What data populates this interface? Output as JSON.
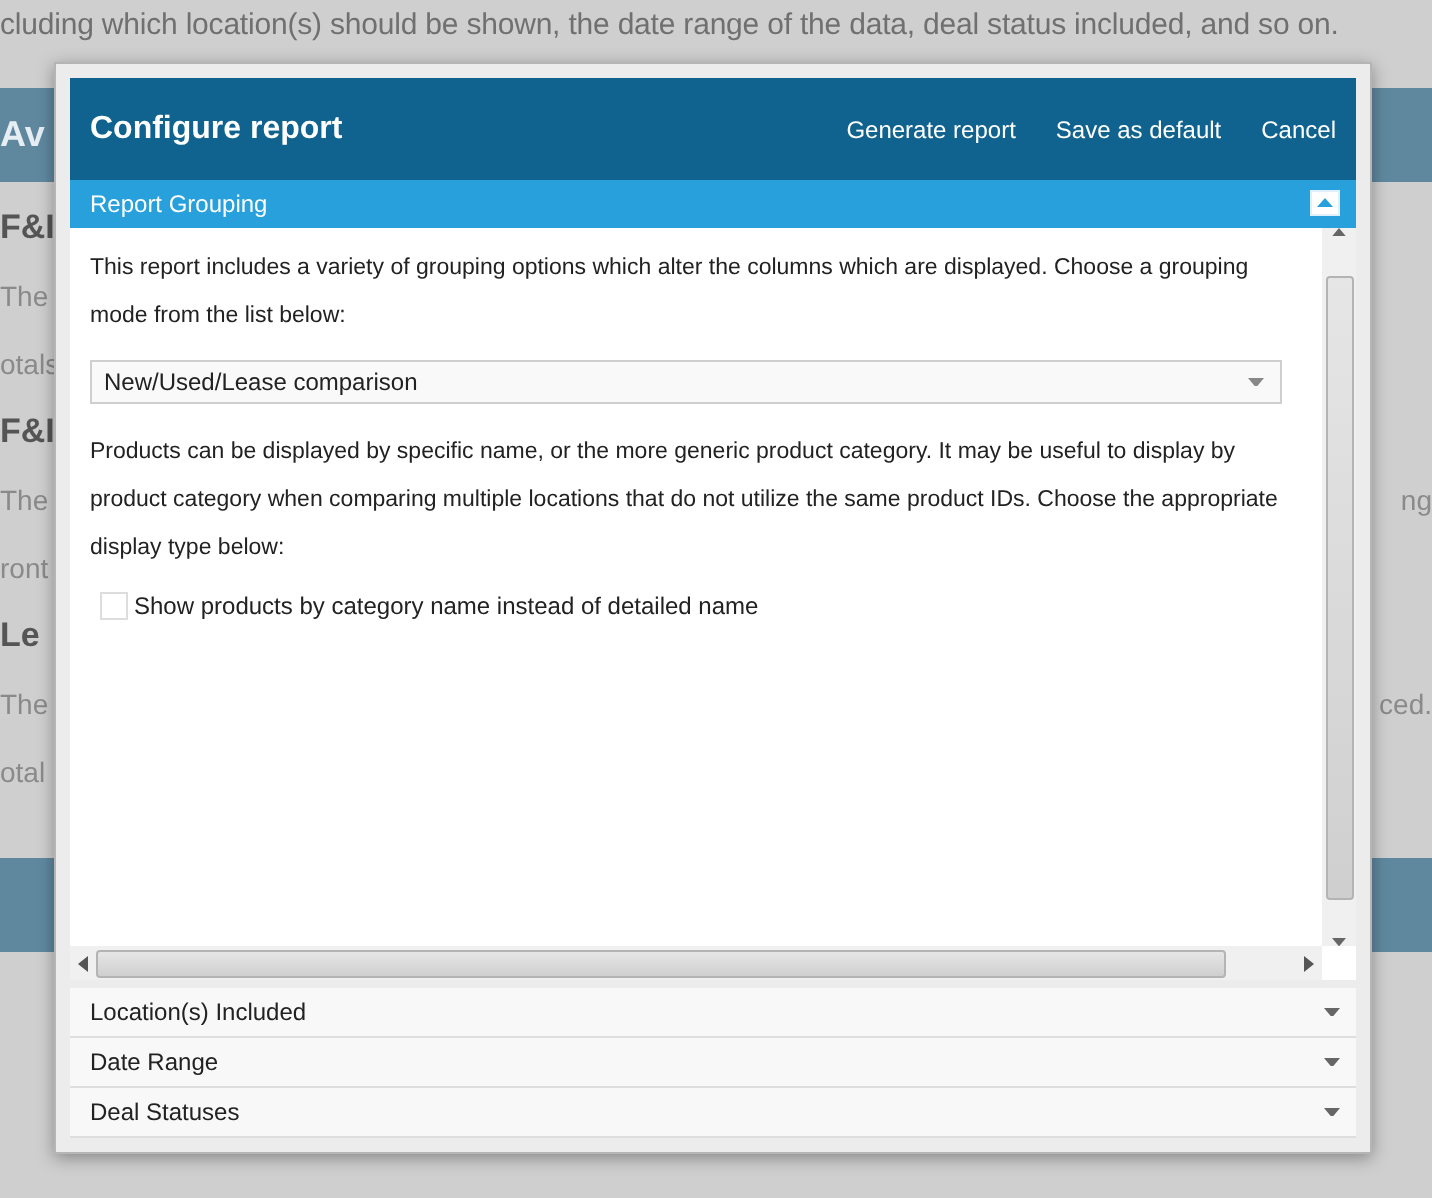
{
  "background": {
    "intro": "cluding which location(s) should be shown, the date range of the data, deal status included, and so on.",
    "band_label": "Av",
    "rows": [
      {
        "kind": "heading",
        "left": "F&I"
      },
      {
        "kind": "text",
        "left": "The"
      },
      {
        "kind": "text",
        "left": "otals"
      },
      {
        "kind": "heading",
        "left": "F&I"
      },
      {
        "kind": "text",
        "left": "The",
        "right": "ng"
      },
      {
        "kind": "text",
        "left": "ront"
      },
      {
        "kind": "heading",
        "left": "Le"
      },
      {
        "kind": "text",
        "left": "The",
        "right": "ced."
      },
      {
        "kind": "text",
        "left": "otal"
      }
    ]
  },
  "dialog": {
    "title": "Configure report",
    "actions": [
      "Generate report",
      "Save as default",
      "Cancel"
    ],
    "sections": [
      {
        "label": "Report Grouping",
        "expanded": true
      },
      {
        "label": "Location(s) Included",
        "expanded": false
      },
      {
        "label": "Date Range",
        "expanded": false
      },
      {
        "label": "Deal Statuses",
        "expanded": false
      }
    ],
    "grouping_text": "This report includes a variety of grouping options which alter the columns which are displayed. Choose a grouping mode from the list below:",
    "grouping_select": {
      "value": "New/Used/Lease comparison"
    },
    "products_text": "Products can be displayed by specific name, or the more generic product category. It may be useful to display by product category when comparing multiple locations that do not utilize the same product IDs. Choose the appropriate display type below:",
    "checkbox": {
      "label": "Show products by category name instead of detailed name",
      "checked": false
    }
  }
}
